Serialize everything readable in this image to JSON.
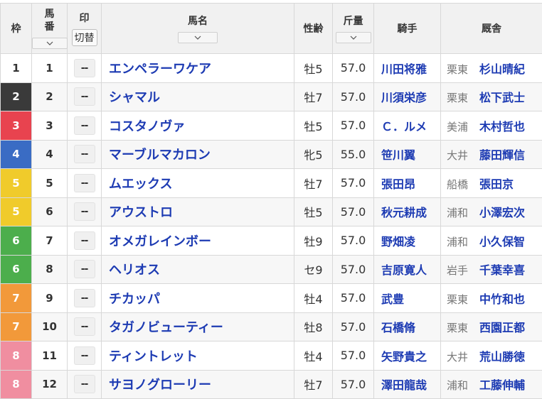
{
  "header": {
    "waku": "枠",
    "umaban": "馬\n番",
    "mark": "印",
    "mark_toggle": "切替",
    "horse_name": "馬名",
    "sex_age": "性齢",
    "weight": "斤量",
    "jockey": "騎手",
    "stable": "厩舎"
  },
  "waku_colors": {
    "1": {
      "bg": "#ffffff",
      "fg": "#333333"
    },
    "2": {
      "bg": "#3a3a3a",
      "fg": "#ffffff"
    },
    "3": {
      "bg": "#e8434f",
      "fg": "#ffffff"
    },
    "4": {
      "bg": "#3a6cc4",
      "fg": "#ffffff"
    },
    "5": {
      "bg": "#f0cb2b",
      "fg": "#ffffff"
    },
    "6": {
      "bg": "#4cae4c",
      "fg": "#ffffff"
    },
    "7": {
      "bg": "#f2993a",
      "fg": "#ffffff"
    },
    "8": {
      "bg": "#f08ea0",
      "fg": "#ffffff"
    }
  },
  "rows": [
    {
      "waku": "1",
      "umaban": "1",
      "mark": "--",
      "horse": "エンペラーワケア",
      "sexage": "牡5",
      "weight": "57.0",
      "jockey": "川田将雅",
      "region": "栗東",
      "trainer": "杉山晴紀"
    },
    {
      "waku": "2",
      "umaban": "2",
      "mark": "--",
      "horse": "シャマル",
      "sexage": "牡7",
      "weight": "57.0",
      "jockey": "川須栄彦",
      "region": "栗東",
      "trainer": "松下武士"
    },
    {
      "waku": "3",
      "umaban": "3",
      "mark": "--",
      "horse": "コスタノヴァ",
      "sexage": "牡5",
      "weight": "57.0",
      "jockey": "Ｃ．ルメ",
      "region": "美浦",
      "trainer": "木村哲也"
    },
    {
      "waku": "4",
      "umaban": "4",
      "mark": "--",
      "horse": "マーブルマカロン",
      "sexage": "牝5",
      "weight": "55.0",
      "jockey": "笹川翼",
      "region": "大井",
      "trainer": "藤田輝信"
    },
    {
      "waku": "5",
      "umaban": "5",
      "mark": "--",
      "horse": "ムエックス",
      "sexage": "牡7",
      "weight": "57.0",
      "jockey": "張田昂",
      "region": "船橋",
      "trainer": "張田京"
    },
    {
      "waku": "5",
      "umaban": "6",
      "mark": "--",
      "horse": "アウストロ",
      "sexage": "牡5",
      "weight": "57.0",
      "jockey": "秋元耕成",
      "region": "浦和",
      "trainer": "小澤宏次"
    },
    {
      "waku": "6",
      "umaban": "7",
      "mark": "--",
      "horse": "オメガレインボー",
      "sexage": "牡9",
      "weight": "57.0",
      "jockey": "野畑凌",
      "region": "浦和",
      "trainer": "小久保智"
    },
    {
      "waku": "6",
      "umaban": "8",
      "mark": "--",
      "horse": "ヘリオス",
      "sexage": "セ9",
      "weight": "57.0",
      "jockey": "吉原寛人",
      "region": "岩手",
      "trainer": "千葉幸喜"
    },
    {
      "waku": "7",
      "umaban": "9",
      "mark": "--",
      "horse": "チカッパ",
      "sexage": "牡4",
      "weight": "57.0",
      "jockey": "武豊",
      "region": "栗東",
      "trainer": "中竹和也"
    },
    {
      "waku": "7",
      "umaban": "10",
      "mark": "--",
      "horse": "タガノビューティー",
      "sexage": "牡8",
      "weight": "57.0",
      "jockey": "石橋脩",
      "region": "栗東",
      "trainer": "西園正都"
    },
    {
      "waku": "8",
      "umaban": "11",
      "mark": "--",
      "horse": "ティントレット",
      "sexage": "牡4",
      "weight": "57.0",
      "jockey": "矢野貴之",
      "region": "大井",
      "trainer": "荒山勝徳"
    },
    {
      "waku": "8",
      "umaban": "12",
      "mark": "--",
      "horse": "サヨノグローリー",
      "sexage": "牡7",
      "weight": "57.0",
      "jockey": "澤田龍哉",
      "region": "浦和",
      "trainer": "工藤伸輔"
    }
  ],
  "icons": {
    "sort": "chevron-down-icon"
  }
}
